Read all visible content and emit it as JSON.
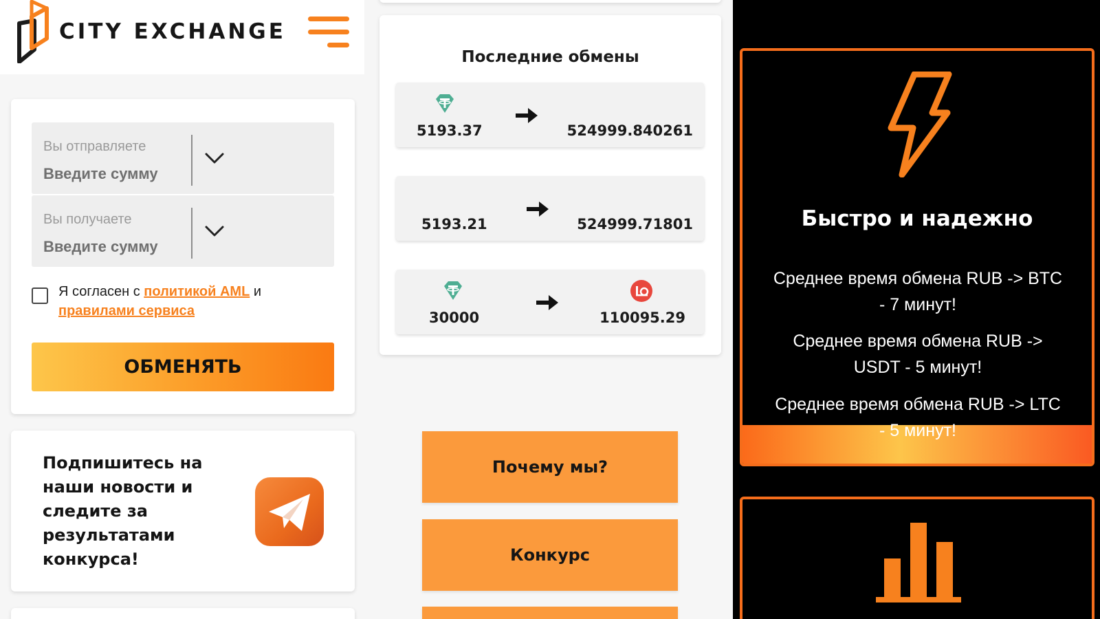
{
  "header": {
    "brand": "CITY EXCHANGE",
    "menu_icon": "hamburger-menu-icon"
  },
  "exchange_form": {
    "send_label": "Вы отправляете",
    "send_placeholder": "Введите сумму",
    "receive_label": "Вы получаете",
    "receive_placeholder": "Введите сумму",
    "agree_prefix": "Я согласен с ",
    "aml_link": "политикой AML",
    "agree_middle": " и",
    "rules_link": "правилами сервиса",
    "submit_label": "ОБМЕНЯТЬ",
    "agreed": false
  },
  "news": {
    "text": "Подпишитесь на наши новости и следите за результатами конкурса!",
    "icon": "telegram-icon"
  },
  "last_exchanges": {
    "title": "Последние обмены",
    "rows": [
      {
        "from_amount": "5193.37",
        "to_amount": "524999.840261",
        "from_icon": "tether-icon",
        "to_icon": ""
      },
      {
        "from_amount": "5193.21",
        "to_amount": "524999.71801",
        "from_icon": "",
        "to_icon": ""
      },
      {
        "from_amount": "30000",
        "to_amount": "110095.29",
        "from_icon": "tether-icon",
        "to_icon": "currency-red-coin-icon"
      }
    ]
  },
  "menu_buttons": [
    "Почему мы?",
    "Конкурс"
  ],
  "features": [
    {
      "icon": "lightning-bolt-icon",
      "title": "Быстро и надежно",
      "lines": [
        "Среднее время обмена RUB -> BTC - 7 минут!",
        "Среднее время обмена RUB -> USDT - 5 минут!",
        "Среднее время обмена RUB -> LTC - 5 минут!"
      ]
    },
    {
      "icon": "bar-chart-icon"
    }
  ],
  "colors": {
    "accent": "#f7811e",
    "button_orange": "#fb9a3c",
    "dark_panel": "#000000",
    "border_orange": "#f56d1b",
    "tether_green": "#4fae93"
  }
}
